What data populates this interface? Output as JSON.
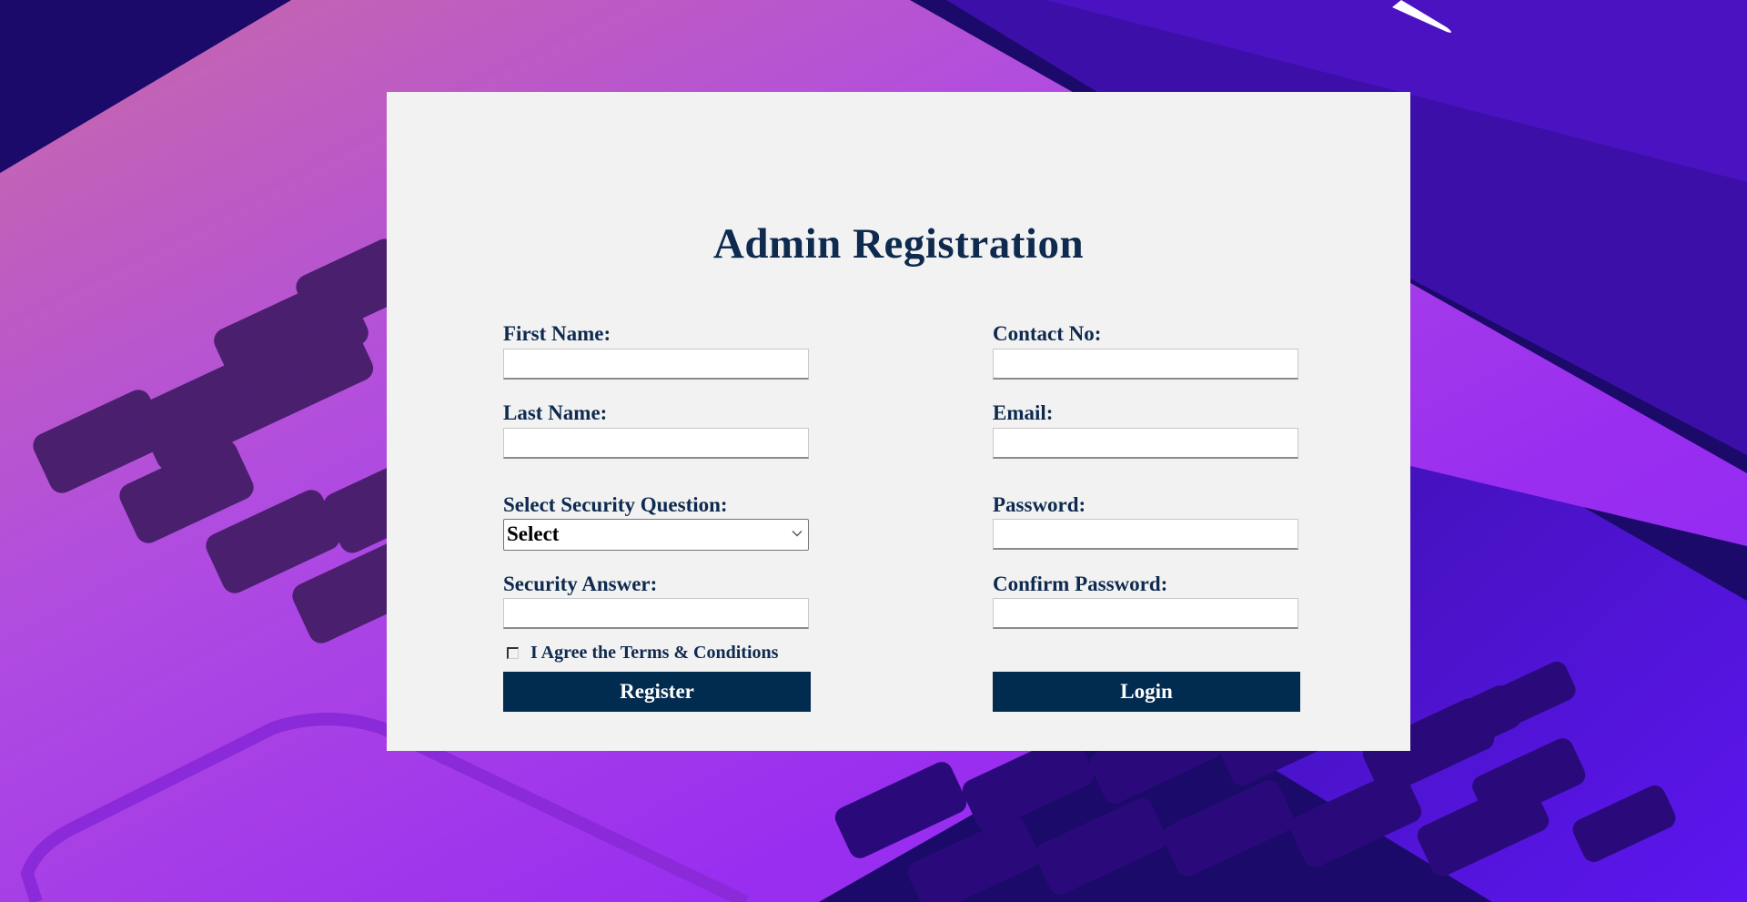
{
  "page": {
    "title": "Admin Registration"
  },
  "form": {
    "first_name": {
      "label": "First Name:",
      "value": ""
    },
    "last_name": {
      "label": "Last Name:",
      "value": ""
    },
    "security_question": {
      "label": "Select Security Question:",
      "selected": "Select"
    },
    "security_answer": {
      "label": "Security Answer:",
      "value": ""
    },
    "contact_no": {
      "label": "Contact No:",
      "value": ""
    },
    "email": {
      "label": "Email:",
      "value": ""
    },
    "password": {
      "label": "Password:",
      "value": ""
    },
    "confirm_password": {
      "label": "Confirm Password:",
      "value": ""
    },
    "terms": {
      "label": "I Agree the Terms & Conditions",
      "checked": false
    }
  },
  "buttons": {
    "register": "Register",
    "login": "Login"
  },
  "colors": {
    "panel_bg": "#f2f2f2",
    "label_text": "#0e2a4f",
    "button_bg": "#022b50",
    "button_text": "#ffffff",
    "background_gradient": [
      "#1a0770",
      "#5a18e8"
    ]
  }
}
